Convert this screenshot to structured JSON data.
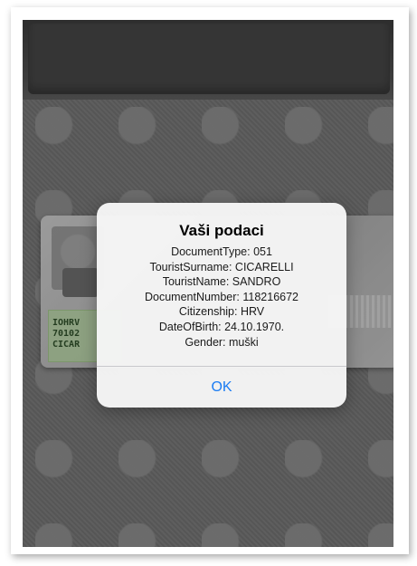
{
  "card": {
    "mrz_lines": [
      "IOHRV",
      "70102",
      "CICAR"
    ]
  },
  "alert": {
    "title": "Vaši podaci",
    "lines": [
      "DocumentType: 051",
      "TouristSurname: CICARELLI",
      "TouristName: SANDRO",
      "DocumentNumber: 118216672",
      "Citizenship: HRV",
      "DateOfBirth: 24.10.1970.",
      "Gender: muški"
    ],
    "ok_label": "OK"
  },
  "colors": {
    "accent": "#1b7cf3",
    "alert_bg": "#f6f6f6"
  }
}
